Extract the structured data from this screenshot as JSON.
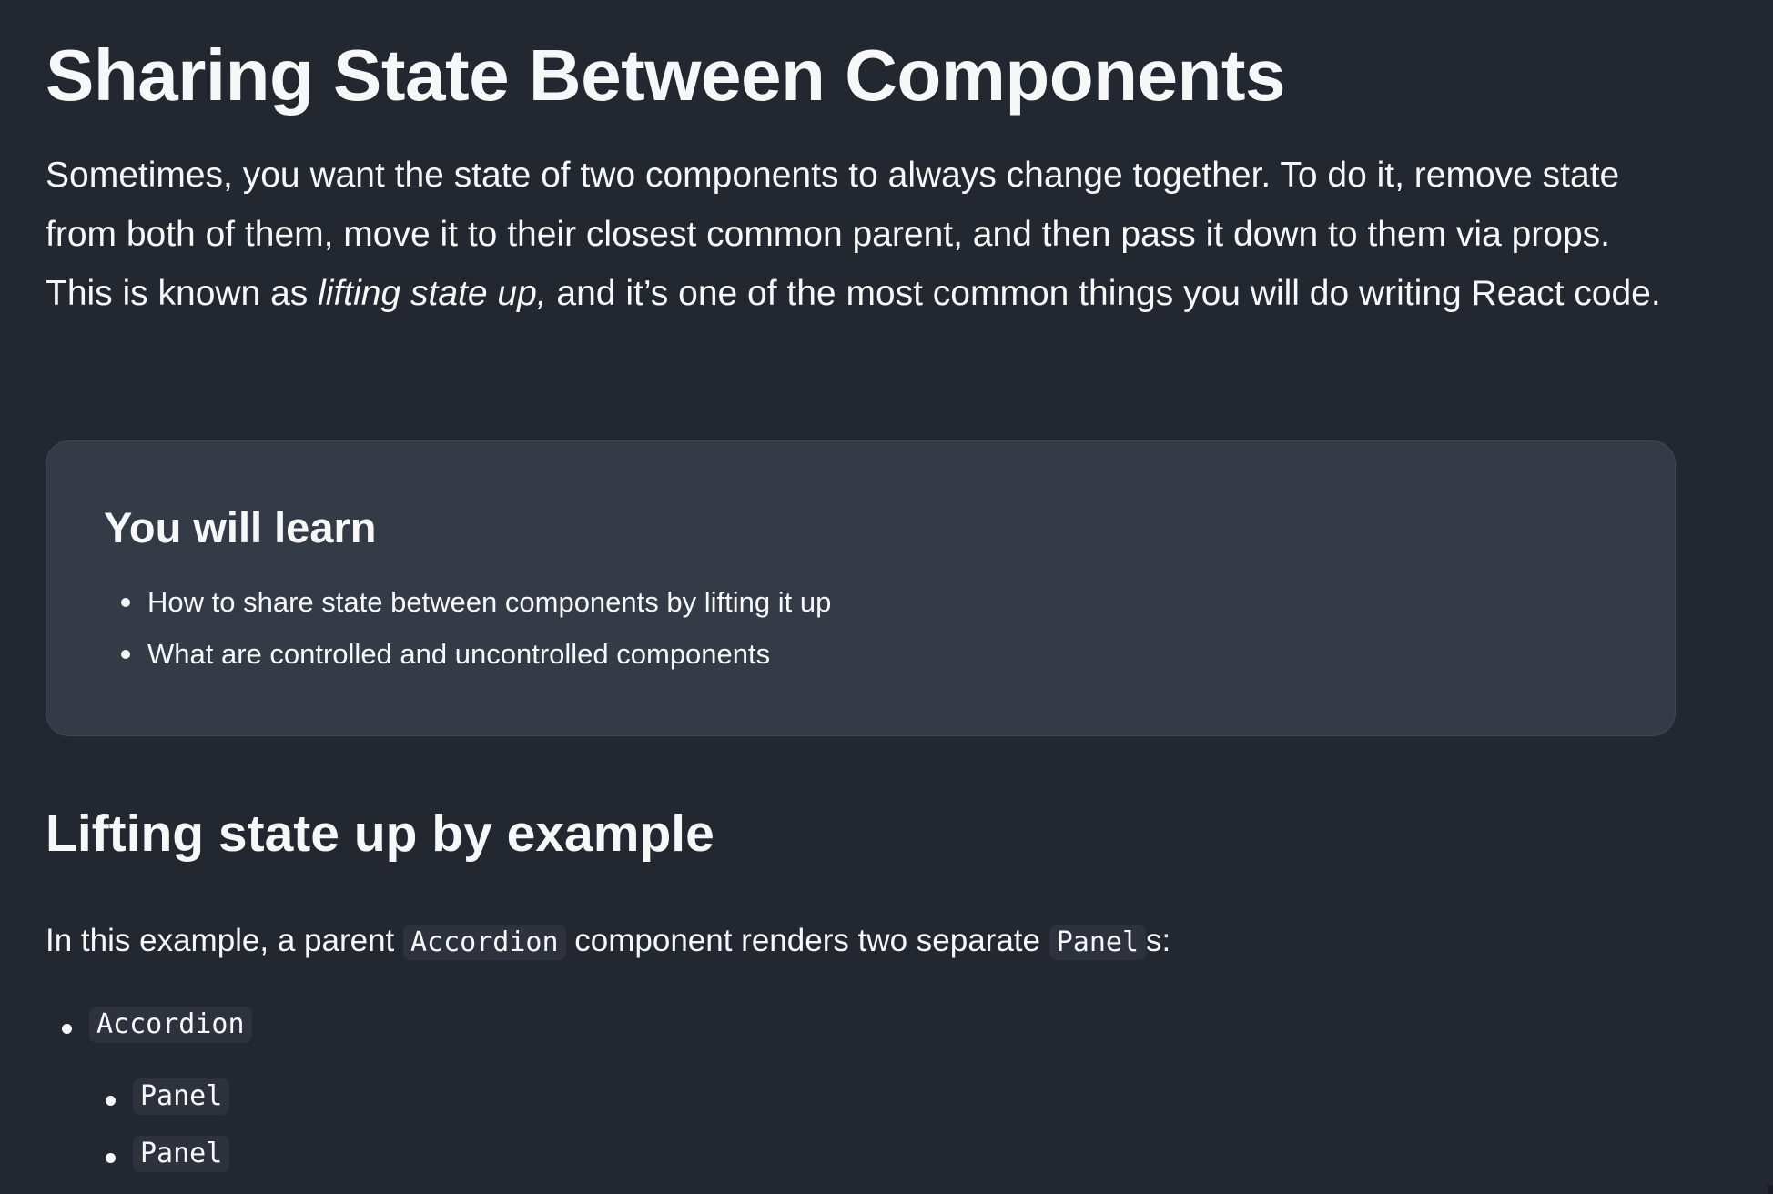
{
  "page": {
    "title": "Sharing State Between Components",
    "intro": {
      "before": "Sometimes, you want the state of two components to always change together. To do it, remove state from both of them, move it to their closest common parent, and then pass it down to them via props. This is known as ",
      "emphasis": "lifting state up,",
      "after": " and it’s one of the most common things you will do writing React code."
    }
  },
  "learn": {
    "title": "You will learn",
    "items": [
      "How to share state between components by lifting it up",
      "What are controlled and uncontrolled components"
    ]
  },
  "section": {
    "title": "Lifting state up by example",
    "text_before": "In this example, a parent ",
    "code_accordion": "Accordion",
    "text_middle": " component renders two separate ",
    "code_panel": "Panel",
    "text_after": "s:",
    "tree": {
      "root": "Accordion",
      "children": [
        "Panel",
        "Panel"
      ]
    }
  },
  "colors": {
    "background": "#23272f",
    "card": "#343a46",
    "text": "#f6f7f9",
    "code_bg": "#2d323c"
  }
}
